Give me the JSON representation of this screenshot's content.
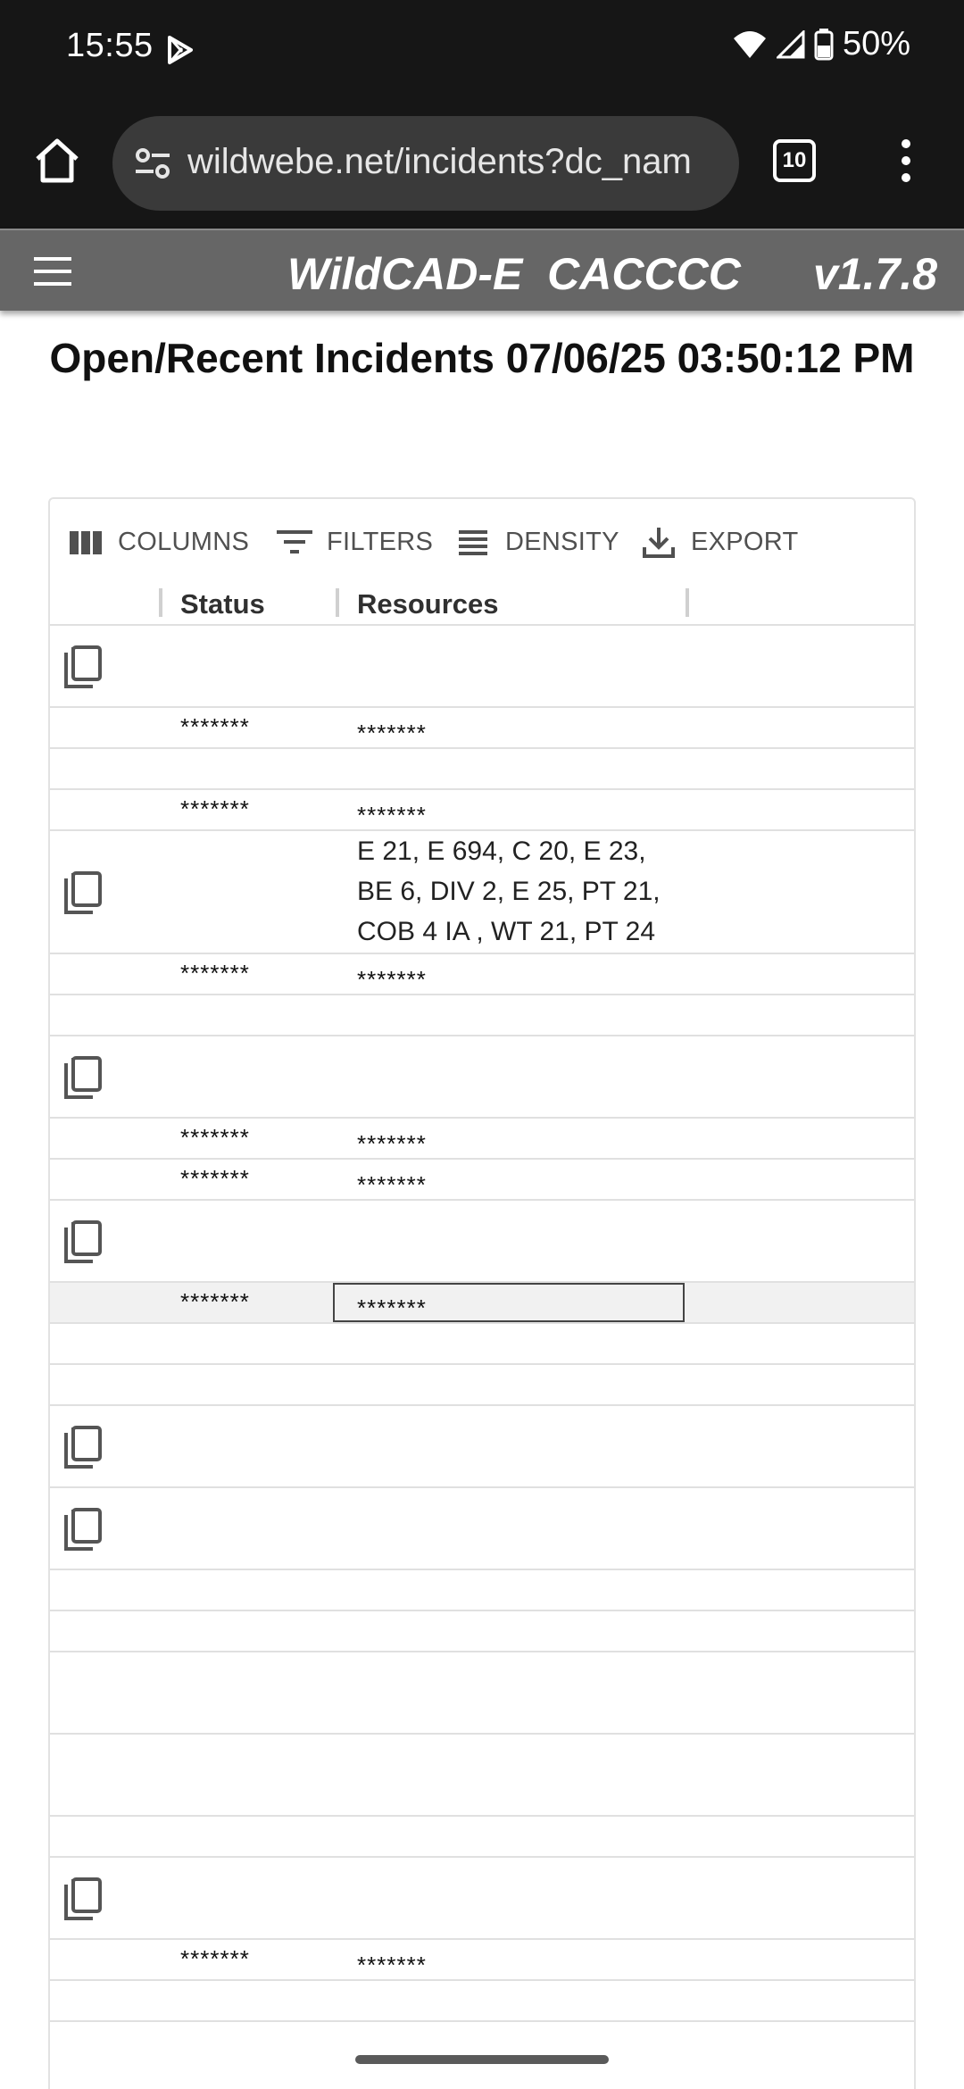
{
  "status_bar": {
    "time": "15:55",
    "battery": "50%"
  },
  "browser": {
    "url": "wildwebe.net/incidents?dc_nam",
    "tab_count": "10"
  },
  "app_header": {
    "title": "WildCAD-E  CACCCC",
    "version": "v1.7.8"
  },
  "page": {
    "title": "Open/Recent Incidents 07/06/25 03:50:12 PM"
  },
  "toolbar": {
    "columns": "COLUMNS",
    "filters": "FILTERS",
    "density": "DENSITY",
    "export": "EXPORT"
  },
  "columns": {
    "status": "Status",
    "resources": "Resources"
  },
  "rows": [
    {
      "copy": true,
      "status": "",
      "resources": ""
    },
    {
      "copy": false,
      "status": "*******",
      "resources": "*******"
    },
    {
      "copy": false,
      "status": "",
      "resources": ""
    },
    {
      "copy": false,
      "status": "*******",
      "resources": "*******"
    },
    {
      "copy": true,
      "status": "",
      "resources": "E 21, E 694, C 20, E 23, BE 6, DIV 2, E 25, PT 21, COB 4 IA , WT 21, PT 24"
    },
    {
      "copy": false,
      "status": "*******",
      "resources": "*******"
    },
    {
      "copy": false,
      "status": "",
      "resources": ""
    },
    {
      "copy": true,
      "status": "",
      "resources": ""
    },
    {
      "copy": false,
      "status": "*******",
      "resources": "*******"
    },
    {
      "copy": false,
      "status": "*******",
      "resources": "*******"
    },
    {
      "copy": true,
      "status": "",
      "resources": ""
    },
    {
      "copy": false,
      "status": "*******",
      "resources": "*******",
      "selected": true
    },
    {
      "copy": false,
      "status": "",
      "resources": ""
    },
    {
      "copy": false,
      "status": "",
      "resources": ""
    },
    {
      "copy": true,
      "status": "",
      "resources": ""
    },
    {
      "copy": true,
      "status": "",
      "resources": ""
    },
    {
      "copy": false,
      "status": "",
      "resources": ""
    },
    {
      "copy": false,
      "status": "",
      "resources": ""
    },
    {
      "copy": false,
      "status": "",
      "resources": ""
    },
    {
      "copy": false,
      "status": "",
      "resources": ""
    },
    {
      "copy": false,
      "status": "",
      "resources": ""
    },
    {
      "copy": true,
      "status": "",
      "resources": ""
    },
    {
      "copy": false,
      "status": "*******",
      "resources": "*******"
    },
    {
      "copy": false,
      "status": "",
      "resources": ""
    }
  ]
}
